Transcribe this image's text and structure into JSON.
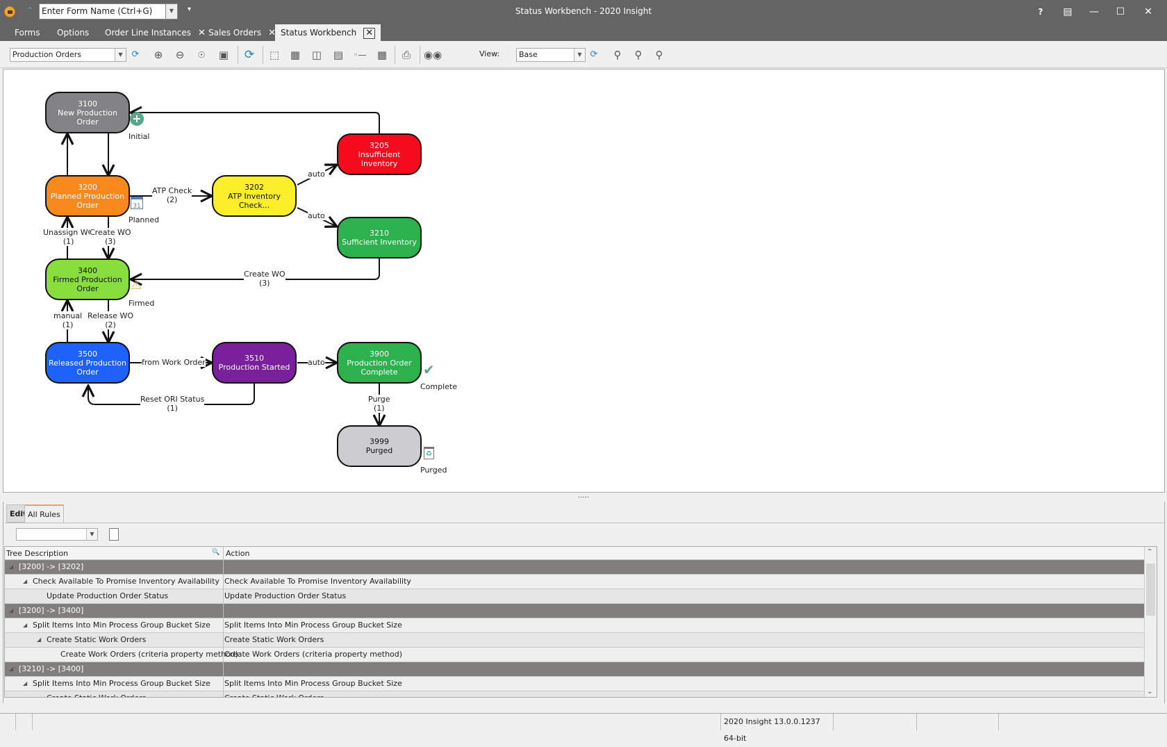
{
  "titlebar": {
    "title": "Status Workbench - 2020 Insight",
    "form_name_placeholder": "Enter Form Name (Ctrl+G)",
    "help": "?",
    "buttons": [
      "restore-up",
      "minimize",
      "maximize",
      "close"
    ]
  },
  "tabs": [
    {
      "label": "Forms",
      "closable": false
    },
    {
      "label": "Options",
      "closable": false
    },
    {
      "label": "Order Line Instances",
      "closable": true
    },
    {
      "label": "Sales Orders",
      "closable": true
    },
    {
      "label": "Status Workbench",
      "closable": true,
      "active": true
    }
  ],
  "toolbar": {
    "workflow_select": "Production Orders",
    "view_label": "View:",
    "view_select": "Base",
    "icons": [
      "refresh-icon",
      "zoom-in-icon",
      "zoom-out-icon",
      "zoom-actual-icon",
      "fit-icon",
      "refresh-layout-icon",
      "select-icon",
      "grid-highlight-icon",
      "columns-icon",
      "rows-icon",
      "connector-icon",
      "table-icon",
      "print-icon",
      "find-icon"
    ]
  },
  "diagram": {
    "nodes": [
      {
        "id": "3100",
        "name": "New Production Order",
        "line1": "3100",
        "line2": "New Production",
        "line3": "Order",
        "color": "#838385"
      },
      {
        "id": "3200",
        "name": "Planned Production Order",
        "line1": "3200",
        "line2": "Planned Production",
        "line3": "Order",
        "color": "#f7891d"
      },
      {
        "id": "3202",
        "name": "ATP Inventory Check...",
        "line1": "3202",
        "line2": "ATP Inventory",
        "line3": "Check...",
        "color": "#fbef2a"
      },
      {
        "id": "3205",
        "name": "Insufficient Inventory",
        "line1": "3205",
        "line2": "Insufficient",
        "line3": "Inventory",
        "color": "#f50a1e"
      },
      {
        "id": "3210",
        "name": "Sufficient Inventory",
        "line1": "3210",
        "line2": "Sufficient Inventory",
        "line3": "",
        "color": "#2cb14e"
      },
      {
        "id": "3400",
        "name": "Firmed Production Order",
        "line1": "3400",
        "line2": "Firmed Production",
        "line3": "Order",
        "color": "#87de3d"
      },
      {
        "id": "3500",
        "name": "Released Production Order",
        "line1": "3500",
        "line2": "Released Production",
        "line3": "Order",
        "color": "#1c62fb"
      },
      {
        "id": "3510",
        "name": "Production Started",
        "line1": "3510",
        "line2": "Production Started",
        "line3": "",
        "color": "#7a209c"
      },
      {
        "id": "3900",
        "name": "Production Order Complete",
        "line1": "3900",
        "line2": "Production Order",
        "line3": "Complete",
        "color": "#2cb14e"
      },
      {
        "id": "3999",
        "name": "Purged",
        "line1": "3999",
        "line2": "Purged",
        "line3": "",
        "color": "#cdcdd1"
      }
    ],
    "edge_labels": [
      {
        "from": "3200",
        "to": "3202",
        "text": "ATP Check",
        "count": "(2)"
      },
      {
        "from": "3202",
        "to": "3205",
        "text": "auto",
        "count": ""
      },
      {
        "from": "3202",
        "to": "3210",
        "text": "auto",
        "count": ""
      },
      {
        "from": "3400",
        "to": "3200",
        "text": "Unassign WO",
        "count": "(1)"
      },
      {
        "from": "3200",
        "to": "3400",
        "text": "Create WO",
        "count": "(3)"
      },
      {
        "from": "3210",
        "to": "3400",
        "text": "Create WO",
        "count": "(3)"
      },
      {
        "from": "3500",
        "to": "3400",
        "text": "manual",
        "count": "(1)"
      },
      {
        "from": "3400",
        "to": "3500",
        "text": "Release WO",
        "count": "(2)"
      },
      {
        "from": "3500",
        "to": "3510",
        "text": "from Work Order",
        "count": ""
      },
      {
        "from": "3510",
        "to": "3900",
        "text": "auto",
        "count": ""
      },
      {
        "from": "3510",
        "to": "3500",
        "text": "Reset ORI Status",
        "count": "(1)"
      },
      {
        "from": "3900",
        "to": "3999",
        "text": "Purge",
        "count": "(1)"
      }
    ],
    "state_labels": {
      "initial": "Initial",
      "planned": "Planned",
      "firmed": "Firmed",
      "complete": "Complete",
      "purged": "Purged"
    }
  },
  "rules_panel": {
    "tabs": [
      "Edit",
      "All Rules"
    ],
    "active_tab": "All Rules",
    "filter_value": "",
    "columns": [
      "Tree Description",
      "Action"
    ],
    "rows": [
      {
        "level": 0,
        "desc": "[3200] -> [3202]",
        "action": ""
      },
      {
        "level": 1,
        "desc": "Check Available To Promise Inventory Availability",
        "action": "Check Available To Promise Inventory Availability"
      },
      {
        "level": 2,
        "desc": "Update Production Order Status",
        "action": "Update Production Order Status"
      },
      {
        "level": 0,
        "desc": "[3200] -> [3400]",
        "action": ""
      },
      {
        "level": 1,
        "desc": "Split Items Into Min Process Group Bucket Size",
        "action": "Split Items Into Min Process Group Bucket Size"
      },
      {
        "level": 2,
        "desc": "Create Static Work Orders",
        "action": "Create Static Work Orders"
      },
      {
        "level": 3,
        "desc": "Create Work Orders (criteria property method)",
        "action": "Create Work Orders (criteria property method)"
      },
      {
        "level": 0,
        "desc": "[3210] -> [3400]",
        "action": ""
      },
      {
        "level": 1,
        "desc": "Split Items Into Min Process Group Bucket Size",
        "action": "Split Items Into Min Process Group Bucket Size"
      },
      {
        "level": 2,
        "desc": "Create Static Work Orders",
        "action": "Create Static Work Orders"
      }
    ]
  },
  "statusbar": {
    "version": "2020 Insight 13.0.0.1237 64-bit"
  }
}
